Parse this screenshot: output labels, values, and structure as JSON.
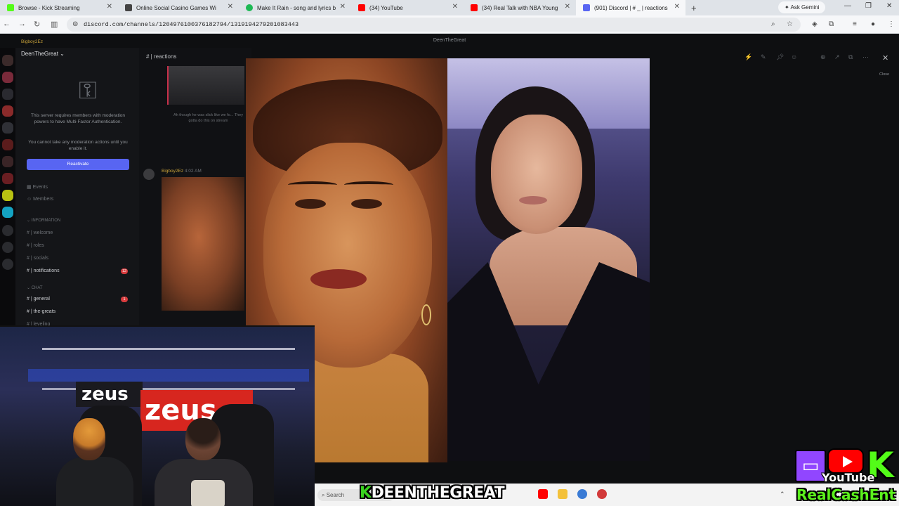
{
  "browser": {
    "tabs": [
      {
        "label": "Browse - Kick Streaming",
        "icon": "kick-icon",
        "color": "#53fc18"
      },
      {
        "label": "Online Social Casino Games Wi",
        "icon": "casino-icon",
        "color": "#444444"
      },
      {
        "label": "Make It Rain - song and lyrics b",
        "icon": "spotify-icon",
        "color": "#1db954"
      },
      {
        "label": "(34) YouTube",
        "icon": "youtube-icon",
        "color": "#ff0000"
      },
      {
        "label": "(34) Real Talk with NBA Young",
        "icon": "youtube-icon",
        "color": "#ff0000"
      },
      {
        "label": "(901) Discord | # _ | reactions",
        "icon": "discord-icon",
        "color": "#5865f2"
      }
    ],
    "new_tab": "+",
    "gemini_label": "Ask Gemini",
    "url": "discord.com/channels/1204976100376182794/1319194279201083443"
  },
  "discord": {
    "window_title": "DeenTheGreat",
    "server_name": "DeenTheGreat",
    "user_name": "Bigboy2Ez",
    "channel_header": "| reactions",
    "mfa_notice": "This server requires members with moderation powers to have Multi-Factor Authentication.",
    "mfa_notice2": "You cannot take any moderation actions until you enable it.",
    "reactivate_label": "Reactivate",
    "nav": [
      {
        "label": "Events",
        "top": 0
      },
      {
        "label": "Members",
        "top": 1
      }
    ],
    "category_information": "INFORMATION",
    "channels_info": [
      "welcome",
      "roles",
      "socials",
      "notifications"
    ],
    "notifications_badge": "12",
    "category_chat": "CHAT",
    "channels_chat": [
      "general",
      "the-greats",
      "leveling"
    ],
    "general_badge": "1",
    "chat_caption": "Ah though he was slick like we fo... They gotta do this on stream",
    "message_author": "Bigboy2Ez",
    "message_time": "4:02 AM",
    "close_tooltip": "Close"
  },
  "stream": {
    "caption_k": "K",
    "caption_rest": "DEENTHEGREAT",
    "cam_sign_1": "zeus",
    "cam_sign_2": "zeus",
    "taskbar_search": "Search",
    "social_youtube": "YouTube",
    "social_channel": "RealCashEnt",
    "kick_letter": "K"
  }
}
